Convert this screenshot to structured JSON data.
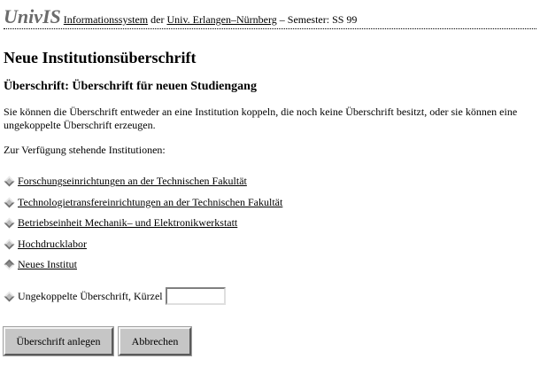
{
  "header": {
    "logo": "UnivIS",
    "info_link": "Informationssystem",
    "der": "der",
    "univ_link": "Univ. Erlangen–Nürnberg",
    "semester": "– Semester: SS 99"
  },
  "page_title": "Neue Institutionsüberschrift",
  "subtitle": "Überschrift: Überschrift für neuen Studiengang",
  "description": "Sie können die Überschrift entweder an eine Institution koppeln, die noch keine Überschrift besitzt, oder sie können eine ungekoppelte Überschrift erzeugen.",
  "available_label": "Zur Verfügung stehende Institutionen:",
  "institutions": [
    {
      "label": "Forschungseinrichtungen an der Technischen Fakultät",
      "selected": false
    },
    {
      "label": "Technologietransfereinrichtungen an der Technischen Fakultät",
      "selected": false
    },
    {
      "label": "Betriebseinheit Mechanik– und Elektronikwerkstatt",
      "selected": false
    },
    {
      "label": "Hochdrucklabor",
      "selected": false
    },
    {
      "label": "Neues Institut",
      "selected": true
    }
  ],
  "uncoupled": {
    "label": "Ungekoppelte Überschrift, Kürzel",
    "value": "",
    "selected": false
  },
  "buttons": {
    "create": "Überschrift anlegen",
    "cancel": "Abbrechen"
  },
  "icons": {
    "radio": "diamond-radio-icon"
  }
}
